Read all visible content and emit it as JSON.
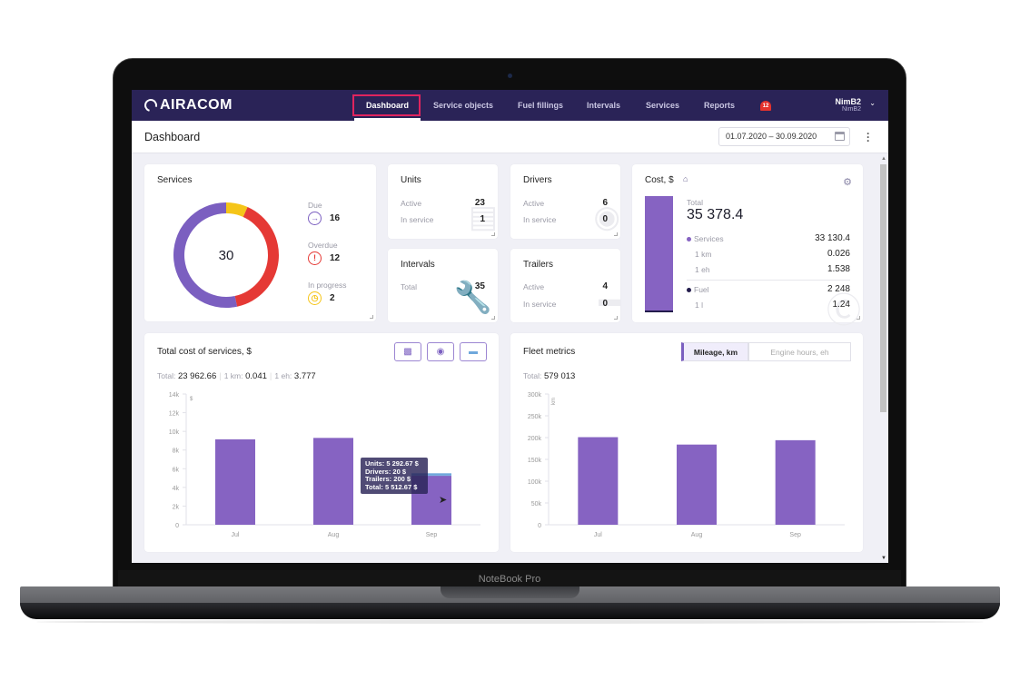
{
  "device": {
    "brand_label": "NoteBook Pro"
  },
  "app": {
    "logo": "AIRACOM",
    "nav": [
      {
        "label": "Dashboard",
        "active": true
      },
      {
        "label": "Service objects",
        "active": false
      },
      {
        "label": "Fuel fillings",
        "active": false
      },
      {
        "label": "Intervals",
        "active": false
      },
      {
        "label": "Services",
        "active": false
      },
      {
        "label": "Reports",
        "active": false
      }
    ],
    "notifications": {
      "icon": "bell-icon",
      "count": "12"
    },
    "user": {
      "name": "NimB2",
      "sub": "NimB2"
    }
  },
  "page": {
    "title": "Dashboard",
    "date_range": "01.07.2020 – 30.09.2020"
  },
  "services_card": {
    "title": "Services",
    "total": "30",
    "legend": [
      {
        "label": "Due",
        "value": "16",
        "icon": "arrow-right-icon",
        "color": "#7b5fc0"
      },
      {
        "label": "Overdue",
        "value": "12",
        "icon": "exclamation-icon",
        "color": "#e53935"
      },
      {
        "label": "In progress",
        "value": "2",
        "icon": "clock-icon",
        "color": "#f5c518"
      }
    ]
  },
  "units_card": {
    "title": "Units",
    "rows": [
      {
        "label": "Active",
        "value": "23"
      },
      {
        "label": "In service",
        "value": "1"
      }
    ]
  },
  "drivers_card": {
    "title": "Drivers",
    "rows": [
      {
        "label": "Active",
        "value": "6"
      },
      {
        "label": "In service",
        "value": "0"
      }
    ]
  },
  "intervals_card": {
    "title": "Intervals",
    "rows": [
      {
        "label": "Total",
        "value": "35"
      }
    ]
  },
  "trailers_card": {
    "title": "Trailers",
    "rows": [
      {
        "label": "Active",
        "value": "4"
      },
      {
        "label": "In service",
        "value": "0"
      }
    ]
  },
  "cost_card": {
    "title": "Cost, $",
    "total_label": "Total",
    "total": "35 378.4",
    "services": {
      "label": "Services",
      "value": "33 130.4",
      "color": "#8663c2"
    },
    "per_km": {
      "label": "1 km",
      "value": "0.026"
    },
    "per_eh": {
      "label": "1 eh",
      "value": "1.538"
    },
    "fuel": {
      "label": "Fuel",
      "value": "2 248",
      "color": "#231c4c"
    },
    "per_l": {
      "label": "1 l",
      "value": "1.24"
    }
  },
  "total_cost_card": {
    "title": "Total cost of services, $",
    "summary": {
      "total_label": "Total:",
      "total": "23 962.66",
      "km_label": "1 km:",
      "km": "0.041",
      "eh_label": "1 eh:",
      "eh": "3.777"
    },
    "filters": [
      {
        "icon": "car-icon"
      },
      {
        "icon": "steering-wheel-icon"
      },
      {
        "icon": "trailer-icon"
      }
    ],
    "tooltip": [
      "Units: 5 292.67 $",
      "Drivers: 20 $",
      "Trailers: 200 $",
      "Total: 5 512.67 $"
    ]
  },
  "fleet_card": {
    "title": "Fleet metrics",
    "tabs": [
      {
        "label": "Mileage, km",
        "active": true
      },
      {
        "label": "Engine hours, eh",
        "active": false
      }
    ],
    "summary": {
      "total_label": "Total:",
      "total": "579 013"
    }
  },
  "chart_data": [
    {
      "type": "bar",
      "title": "Total cost of services, $",
      "categories": [
        "Jul",
        "Aug",
        "Sep"
      ],
      "series": [
        {
          "name": "Units",
          "values": [
            9150,
            9300,
            5292.67
          ],
          "color": "#8663c2"
        },
        {
          "name": "Drivers",
          "values": [
            0,
            0,
            20
          ],
          "color": "#6fa8dc"
        },
        {
          "name": "Trailers",
          "values": [
            0,
            0,
            200
          ],
          "color": "#6fa8dc"
        }
      ],
      "ylabel": "$",
      "ylim": [
        0,
        14000
      ],
      "yticks": [
        "0",
        "2k",
        "4k",
        "6k",
        "8k",
        "10k",
        "12k",
        "14k"
      ],
      "grid": false
    },
    {
      "type": "bar",
      "title": "Fleet metrics",
      "categories": [
        "Jul",
        "Aug",
        "Sep"
      ],
      "series": [
        {
          "name": "Mileage, km",
          "values": [
            201000,
            184000,
            194000
          ],
          "color": "#8663c2"
        }
      ],
      "ylabel": "km",
      "ylim": [
        0,
        300000
      ],
      "yticks": [
        "0",
        "50k",
        "100k",
        "150k",
        "200k",
        "250k",
        "300k"
      ],
      "grid": false
    }
  ]
}
